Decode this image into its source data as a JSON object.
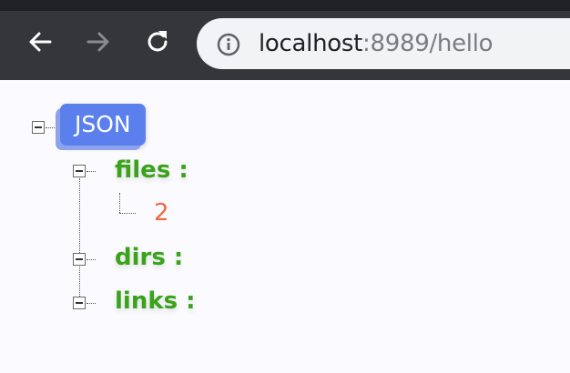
{
  "browser": {
    "url_host": "localhost",
    "url_rest": ":8989/hello"
  },
  "tree": {
    "root_label": "JSON",
    "nodes": [
      {
        "key": "files :",
        "value": "2"
      },
      {
        "key": "dirs :"
      },
      {
        "key": "links :"
      }
    ]
  },
  "colors": {
    "root_badge": "#5b7fed",
    "key_text": "#3aa31a",
    "value_text": "#f0683e",
    "toolbar": "#35363a"
  }
}
